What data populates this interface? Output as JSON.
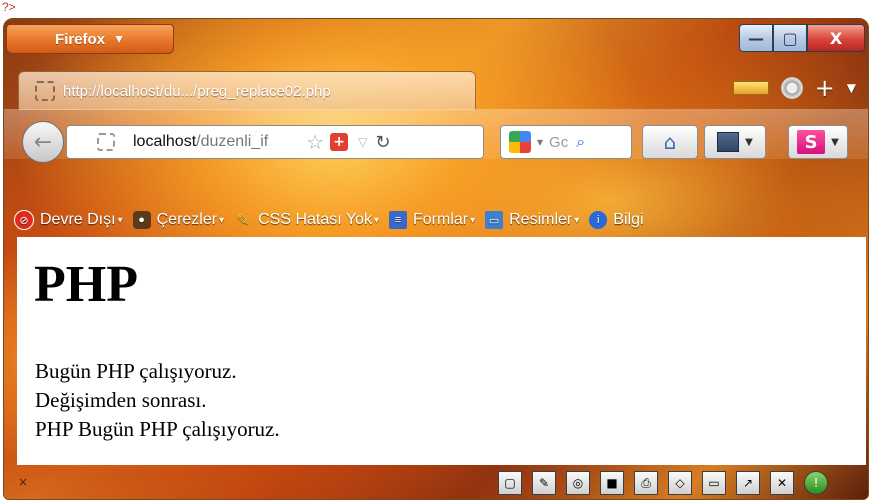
{
  "top_code": "?>",
  "window": {
    "app_button": "Firefox",
    "controls": {
      "minimize": "—",
      "maximize": "▢",
      "close": "X"
    }
  },
  "tab": {
    "title": "http://localhost/du.../preg_replace02.php"
  },
  "navbar": {
    "url_host": "localhost",
    "url_path": "/duzenli_if",
    "search_text": "Gc"
  },
  "bookmarks": [
    {
      "label": "Devre Dışı",
      "icon": "disable-icon"
    },
    {
      "label": "Çerezler",
      "icon": "cookie-user-icon"
    },
    {
      "label": "CSS Hatası Yok",
      "icon": "css-wand-icon"
    },
    {
      "label": "Formlar",
      "icon": "forms-icon"
    },
    {
      "label": "Resimler",
      "icon": "images-icon"
    },
    {
      "label": "Bilgi",
      "icon": "info-icon"
    }
  ],
  "content": {
    "heading": "PHP",
    "lines": [
      "Bugün PHP çalışıyoruz.",
      "Değişimden sonrası.",
      "PHP Bugün PHP çalışıyoruz."
    ]
  },
  "status": {
    "left_text": "×"
  }
}
